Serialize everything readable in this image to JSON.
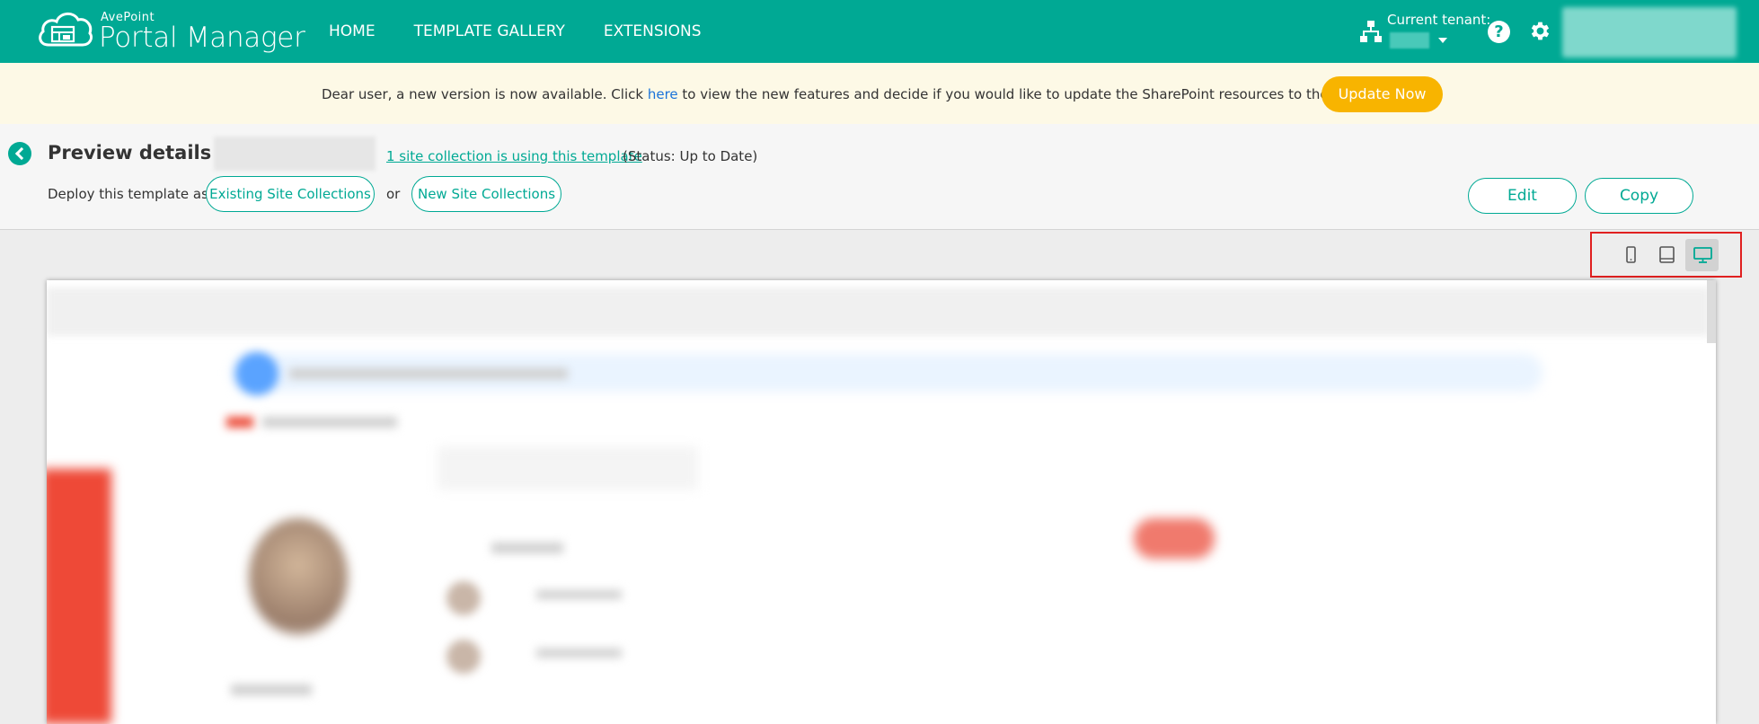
{
  "header": {
    "brand_small": "AvePoint",
    "brand_name": "Portal Manager",
    "nav": [
      {
        "label": "HOME"
      },
      {
        "label": "TEMPLATE GALLERY"
      },
      {
        "label": "EXTENSIONS"
      }
    ],
    "tenant_label": "Current tenant:",
    "help_symbol": "?"
  },
  "banner": {
    "text_before": "Dear user, a new version is now available. Click ",
    "link_text": "here",
    "text_after": " to view the new features and decide if you would like to update the SharePoint resources to the latest ones?",
    "update_button": "Update Now"
  },
  "details": {
    "title": "Preview details of:",
    "usage_link": "1 site collection is using this template",
    "status": "(Status: Up to Date)",
    "deploy_label": "Deploy this template as:",
    "existing_button": "Existing Site Collections",
    "or_text": "or",
    "new_button": "New Site Collections",
    "edit_button": "Edit",
    "copy_button": "Copy"
  },
  "device_toggle": {
    "selected": "desktop",
    "options": [
      "mobile",
      "tablet",
      "desktop"
    ]
  },
  "colors": {
    "brand": "#00a994",
    "banner_bg": "#fdf9e6",
    "update_button": "#f8b400",
    "link": "#1a73d9",
    "highlight_border": "#e02020"
  }
}
